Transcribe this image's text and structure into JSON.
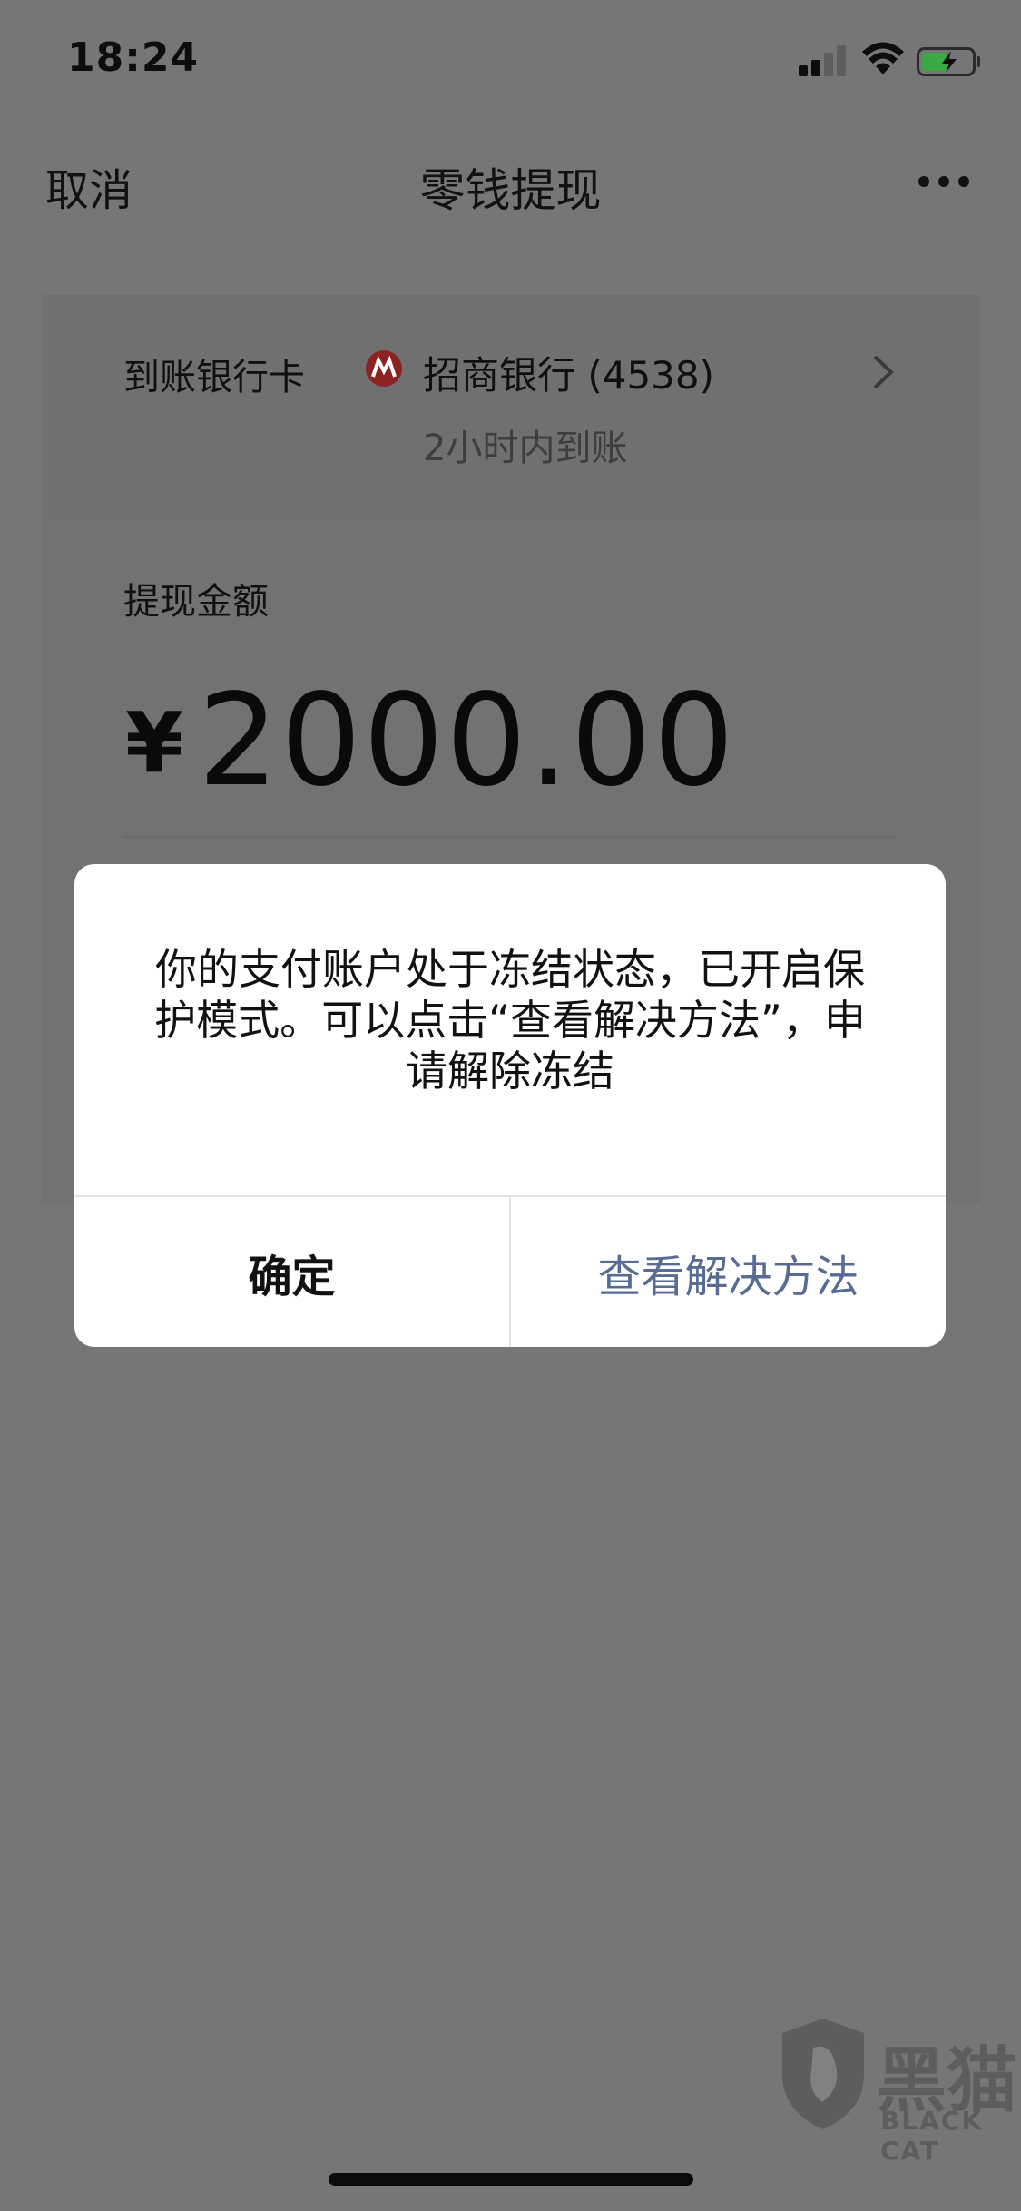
{
  "status_bar": {
    "time": "18:24"
  },
  "nav": {
    "cancel": "取消",
    "title": "零钱提现"
  },
  "bank": {
    "label": "到账银行卡",
    "name": "招商银行 (4538)",
    "arrival": "2小时内到账"
  },
  "amount": {
    "label": "提现金额",
    "currency": "¥",
    "value": "2000.00"
  },
  "dialog": {
    "message": "你的支付账户处于冻结状态，已开启保护模式。可以点击“查看解决方法”，申请解除冻结",
    "confirm": "确定",
    "view_solution": "查看解决方法"
  },
  "watermark": {
    "text": "黑猫",
    "sub": "BLACK CAT"
  },
  "colors": {
    "link_blue": "#576b95",
    "overlay_gray": "#767676",
    "dialog_bg": "#ffffff"
  }
}
